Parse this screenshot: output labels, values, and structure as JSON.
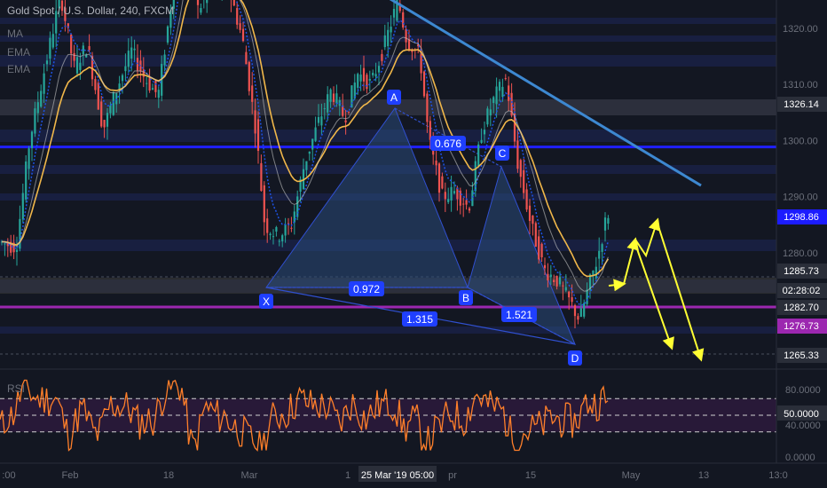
{
  "header": {
    "symbol": "Gold Spot / U.S. Dollar, 240, FXCM",
    "indicators": [
      "MA",
      "EMA",
      "EMA"
    ],
    "rsi_label": "RSI"
  },
  "colors": {
    "background": "#131722",
    "bull": "#26a69a",
    "bear": "#ef5350",
    "ema_fast": "#1e53e5",
    "ema_slow": "#f0b74a",
    "trendline": "#3d88d1",
    "pattern_fill": "#2a4a7a",
    "harmonic_label": "#1f3fff",
    "support_blue": "#2020ff",
    "support_purple": "#9c27b0",
    "projection": "#ffff33",
    "rsi_line": "#ff7f2a"
  },
  "chart_data": [
    {
      "type": "candlestick",
      "title": "Gold Spot / U.S. Dollar, 240, FXCM",
      "ylim": [
        1262,
        1351
      ],
      "y_ticks": [
        1270,
        1280,
        1290,
        1300,
        1310,
        1320,
        1330,
        1340,
        1350
      ],
      "x_tick_labels": [
        ":00",
        "Feb",
        "18",
        "Mar",
        "1",
        "25 Mar '19   05:00",
        "pr",
        "15",
        "May",
        "13",
        "13:0"
      ],
      "x_tick_highlight": "25 Mar '19   05:00",
      "price_tags": [
        {
          "value": "1326.14",
          "style": "gray"
        },
        {
          "value": "1298.86",
          "style": "blue"
        },
        {
          "value": "1285.73",
          "style": "gray"
        },
        {
          "value": "02:28:02",
          "style": "gray"
        },
        {
          "value": "1282.70",
          "style": "gray"
        },
        {
          "value": "1276.73",
          "style": "purple"
        },
        {
          "value": "1265.33",
          "style": "gray"
        }
      ],
      "harmonic_pattern": {
        "points": [
          {
            "label": "X",
            "price": 1298
          },
          {
            "label": "A",
            "price": 1325
          },
          {
            "label": "B",
            "price": 1298
          },
          {
            "label": "C",
            "price": 1313
          },
          {
            "label": "D",
            "price": 1268
          }
        ],
        "ratios": [
          "0.972",
          "1.315",
          "0.676",
          "1.521"
        ]
      },
      "support_levels": [
        1326.14,
        1298.86,
        1282.7,
        1276.73
      ],
      "trendline": {
        "start_price": 1347,
        "end_price": 1292
      },
      "series": [
        {
          "name": "MA"
        },
        {
          "name": "EMA"
        },
        {
          "name": "EMA"
        }
      ]
    },
    {
      "type": "line",
      "title": "RSI",
      "ylim": [
        0,
        100
      ],
      "y_ticks": [
        "80.0000",
        "50.0000",
        "40.0000",
        "0.0000"
      ],
      "current_value": "50.0000",
      "bands": [
        70,
        50,
        30
      ]
    }
  ]
}
